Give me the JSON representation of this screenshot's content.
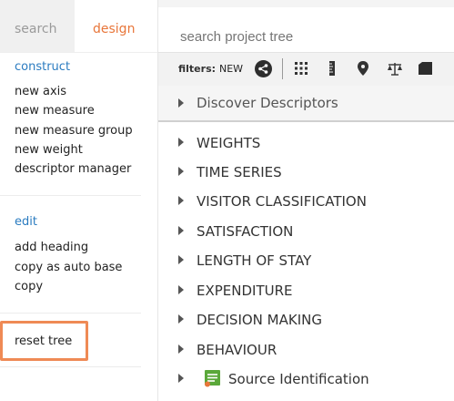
{
  "tabs": {
    "search": "search",
    "design": "design"
  },
  "construct": {
    "heading": "construct",
    "items": [
      "new axis",
      "new measure",
      "new measure group",
      "new weight",
      "descriptor manager"
    ]
  },
  "edit": {
    "heading": "edit",
    "items": [
      "add heading",
      "copy as auto base",
      "copy"
    ]
  },
  "reset": {
    "label": "reset tree"
  },
  "tree_search": {
    "placeholder": "search project tree"
  },
  "toolbar": {
    "filters_label": "filters:",
    "new_label": "NEW"
  },
  "discover": {
    "label": "Discover Descriptors"
  },
  "tree_items": [
    "WEIGHTS",
    "TIME SERIES",
    "VISITOR CLASSIFICATION",
    "SATISFACTION",
    "LENGTH OF STAY",
    "EXPENDITURE",
    "DECISION MAKING",
    "BEHAVIOUR"
  ],
  "source": {
    "label": "Source Identification"
  },
  "colors": {
    "accent_orange": "#e8763a",
    "link_blue": "#2a7bc0",
    "highlight_border": "#ef8a55",
    "source_icon_green": "#5aa83a"
  }
}
